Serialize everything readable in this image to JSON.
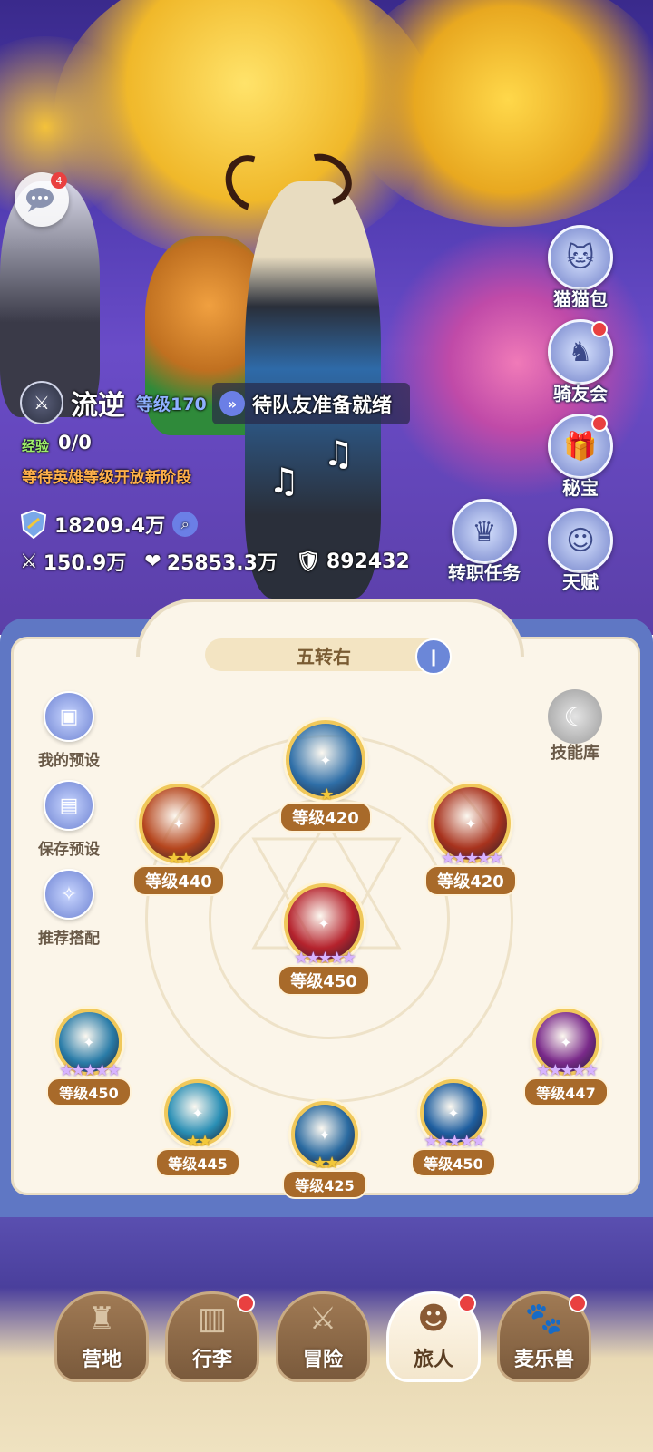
{
  "chat": {
    "badge": "4"
  },
  "player": {
    "name": "流逆",
    "level_label": "等级170",
    "exp_label": "经验",
    "exp_value": "0/0",
    "notice": "等待英雄等级开放新阶段",
    "power": "18209.4万",
    "attack": "150.9万",
    "hp": "25853.3万",
    "defense": "892432"
  },
  "ready": {
    "text": "待队友准备就绪"
  },
  "side_buttons": [
    {
      "label": "猫猫包",
      "icon": "cat-bag-icon",
      "badge": false
    },
    {
      "label": "骑友会",
      "icon": "horse-icon",
      "badge": true
    },
    {
      "label": "秘宝",
      "icon": "treasure-icon",
      "badge": true
    },
    {
      "label": "天赋",
      "icon": "talent-head-icon",
      "badge": false
    }
  ],
  "job_task": {
    "label": "转职任务"
  },
  "panel": {
    "title": "五转右",
    "left_buttons": [
      {
        "label": "我的预设",
        "icon": "preset-icon"
      },
      {
        "label": "保存预设",
        "icon": "save-icon"
      },
      {
        "label": "推荐搭配",
        "icon": "recommend-icon"
      }
    ],
    "skill_library": "技能库"
  },
  "skills": [
    {
      "id": "top",
      "level": "等级420",
      "stars": 1,
      "star_type": "gold",
      "color": "#2f6fa8"
    },
    {
      "id": "upper-left",
      "level": "等级440",
      "stars": 2,
      "star_type": "gold",
      "color": "#b5461e"
    },
    {
      "id": "upper-right",
      "level": "等级420",
      "stars": 5,
      "star_type": "purple",
      "color": "#a8331e"
    },
    {
      "id": "center",
      "level": "等级450",
      "stars": 5,
      "star_type": "purple",
      "color": "#b5232d"
    },
    {
      "id": "ring-1",
      "level": "等级450",
      "stars": 5,
      "star_type": "purple",
      "color": "#2a7ca8"
    },
    {
      "id": "ring-2",
      "level": "等级445",
      "stars": 2,
      "star_type": "gold",
      "color": "#2a8fb5"
    },
    {
      "id": "ring-3",
      "level": "等级425",
      "stars": 2,
      "star_type": "gold",
      "color": "#2a6aa0"
    },
    {
      "id": "ring-4",
      "level": "等级450",
      "stars": 5,
      "star_type": "purple",
      "color": "#1f5fa0"
    },
    {
      "id": "ring-5",
      "level": "等级447",
      "stars": 5,
      "star_type": "purple",
      "color": "#7a2a8a"
    }
  ],
  "tabs": [
    {
      "label": "营地",
      "icon": "castle-icon",
      "badge": false,
      "active": false
    },
    {
      "label": "行李",
      "icon": "backpack-icon",
      "badge": true,
      "active": false
    },
    {
      "label": "冒险",
      "icon": "crossed-swords-icon",
      "badge": false,
      "active": false
    },
    {
      "label": "旅人",
      "icon": "traveler-icon",
      "badge": true,
      "active": true
    },
    {
      "label": "麦乐兽",
      "icon": "pet-icon",
      "badge": true,
      "active": false
    }
  ]
}
